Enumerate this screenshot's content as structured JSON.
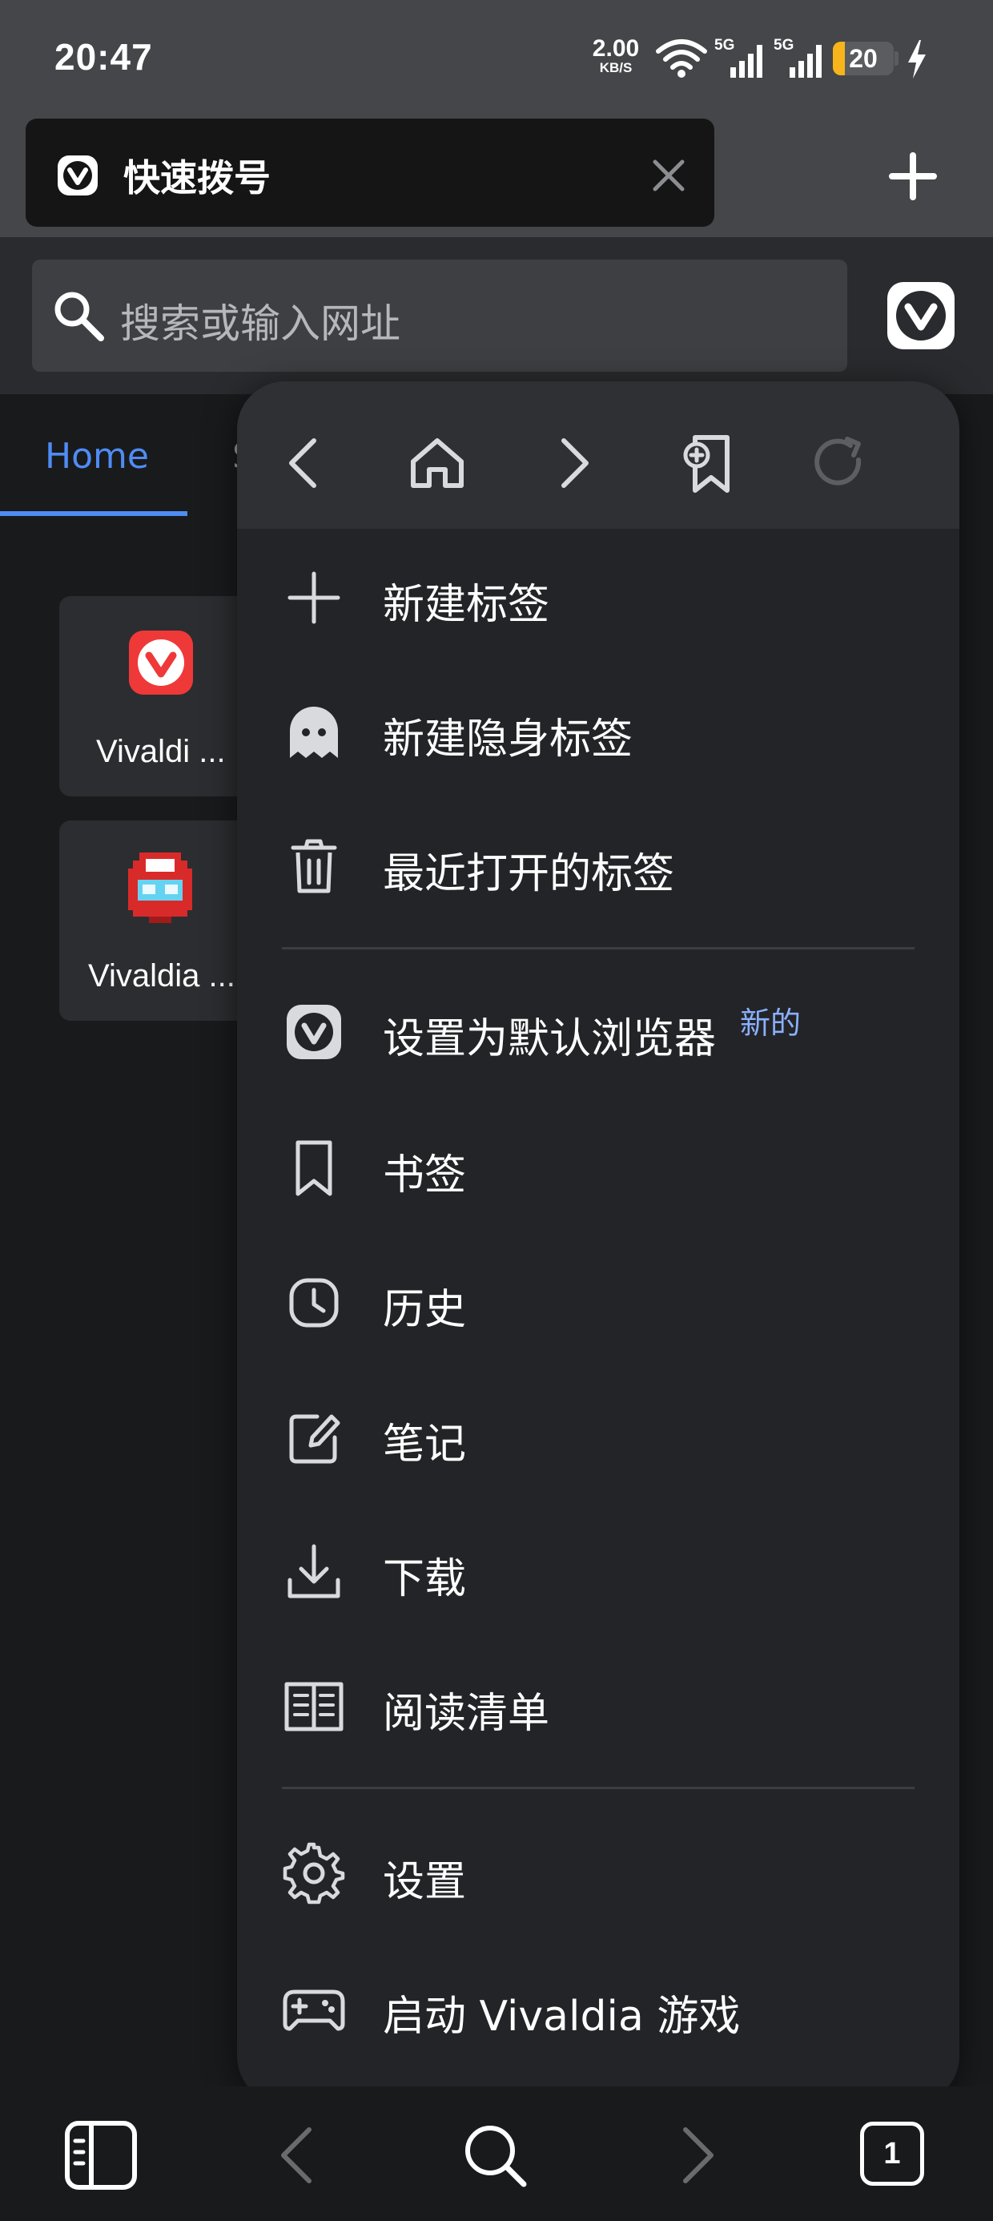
{
  "status_bar": {
    "time": "20:47",
    "net_speed_value": "2.00",
    "net_speed_unit": "KB/S",
    "signal_1_label": "5G",
    "signal_2_label": "5G",
    "battery_level": 20,
    "battery_text": "20",
    "colors": {
      "background": "#454649",
      "battery_fill": "#f7b51b"
    }
  },
  "tab_strip": {
    "active_tab_title": "快速拨号",
    "close_icon": "close-icon",
    "new_tab_icon": "plus-icon"
  },
  "address_bar": {
    "placeholder": "搜索或输入网址",
    "search_icon": "search-icon",
    "menu_icon": "vivaldi-logo-icon"
  },
  "home_page": {
    "tabs": [
      {
        "label": "Home",
        "active": true
      },
      {
        "label": "S",
        "active": false
      }
    ],
    "speed_dials": [
      {
        "label": "Vivaldi ...",
        "icon": "vivaldi-logo-icon"
      },
      {
        "label": "Vivaldia ...",
        "icon": "vivaldia-robot-icon"
      }
    ],
    "accent_color": "#4f8cf4"
  },
  "menu": {
    "nav": [
      {
        "name": "back",
        "icon": "chevron-left-icon",
        "enabled": true
      },
      {
        "name": "home",
        "icon": "home-icon",
        "enabled": true
      },
      {
        "name": "forward",
        "icon": "chevron-right-icon",
        "enabled": true
      },
      {
        "name": "add-bookmark",
        "icon": "bookmark-add-icon",
        "enabled": true
      },
      {
        "name": "reload",
        "icon": "reload-icon",
        "enabled": false
      }
    ],
    "items": [
      {
        "label": "新建标签",
        "icon": "plus-icon"
      },
      {
        "label": "新建隐身标签",
        "icon": "ghost-icon"
      },
      {
        "label": "最近打开的标签",
        "icon": "trash-icon"
      },
      {
        "label": "设置为默认浏览器",
        "icon": "vivaldi-logo-icon",
        "badge": "新的"
      },
      {
        "label": "书签",
        "icon": "bookmark-icon"
      },
      {
        "label": "历史",
        "icon": "clock-icon"
      },
      {
        "label": "笔记",
        "icon": "note-edit-icon"
      },
      {
        "label": "下载",
        "icon": "download-icon"
      },
      {
        "label": "阅读清单",
        "icon": "book-icon"
      },
      {
        "label": "设置",
        "icon": "gear-icon"
      },
      {
        "label": "启动 Vivaldia 游戏",
        "icon": "gamepad-icon"
      }
    ],
    "badge_color": "#8ab0ff"
  },
  "bottom_bar": {
    "panel_icon": "panel-icon",
    "back_icon": "chevron-left-icon",
    "search_icon": "search-icon",
    "forward_icon": "chevron-right-icon",
    "tab_count": "1"
  }
}
